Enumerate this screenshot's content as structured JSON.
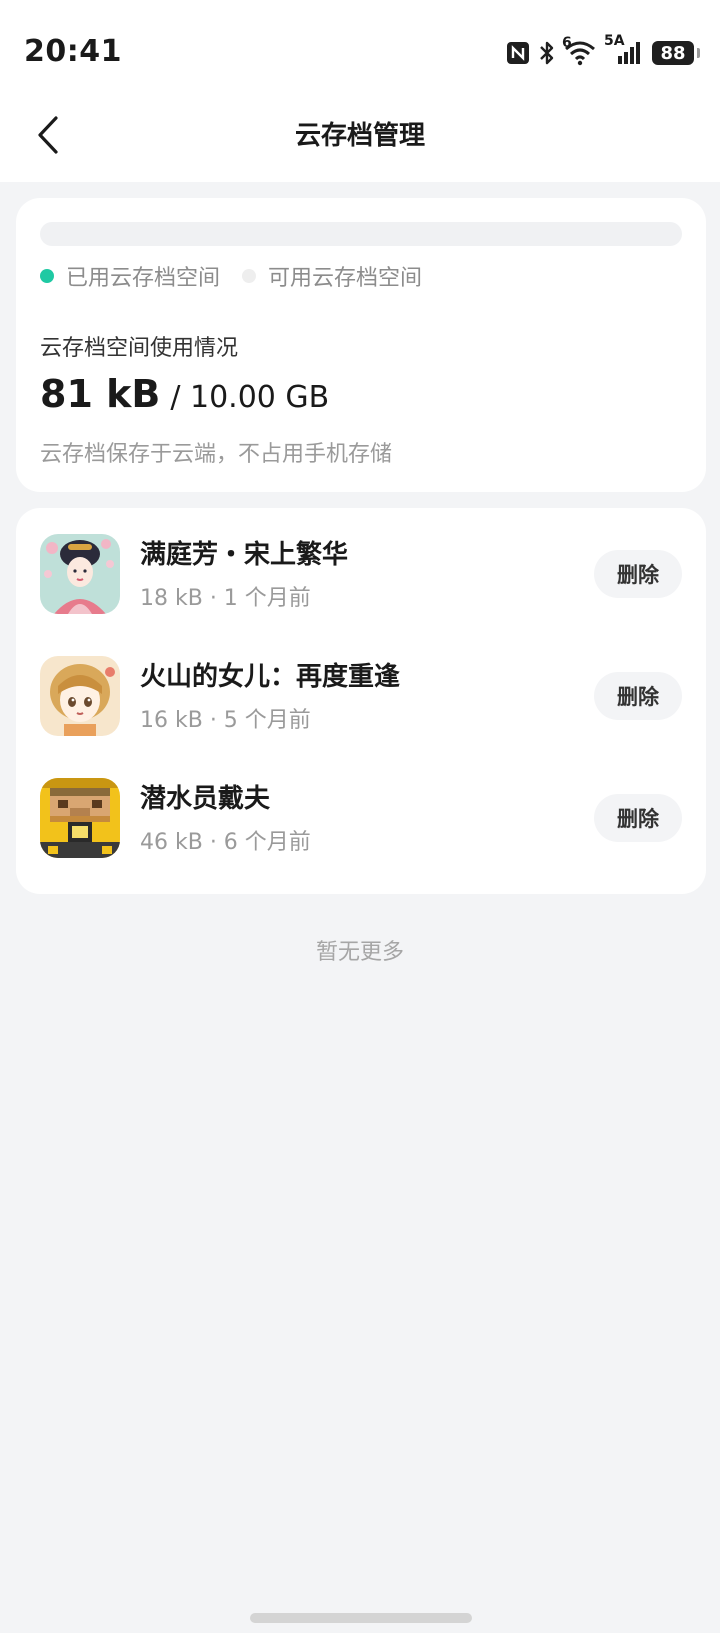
{
  "status_bar": {
    "time": "20:41",
    "network": "5A",
    "wifi_badge": "6",
    "battery": "88"
  },
  "header": {
    "title": "云存档管理"
  },
  "usage": {
    "legend_used": "已用云存档空间",
    "legend_available": "可用云存档空间",
    "used_color": "#1fc9a3",
    "available_color": "#eeeeee",
    "used_fraction": 0.0,
    "label": "云存档空间使用情况",
    "used": "81 kB",
    "total": "/ 10.00 GB",
    "note": "云存档保存于云端，不占用手机存储"
  },
  "saves": [
    {
      "name": "满庭芳・宋上繁华",
      "meta": "18 kB · 1 个月前",
      "delete_label": "删除",
      "icon": "ancient-lady-game-icon"
    },
    {
      "name": "火山的女儿：再度重逢",
      "meta": "16 kB · 5 个月前",
      "delete_label": "删除",
      "icon": "anime-girl-game-icon"
    },
    {
      "name": "潜水员戴夫",
      "meta": "46 kB · 6 个月前",
      "delete_label": "删除",
      "icon": "pixel-diver-game-icon"
    }
  ],
  "footer": {
    "no_more": "暂无更多"
  }
}
